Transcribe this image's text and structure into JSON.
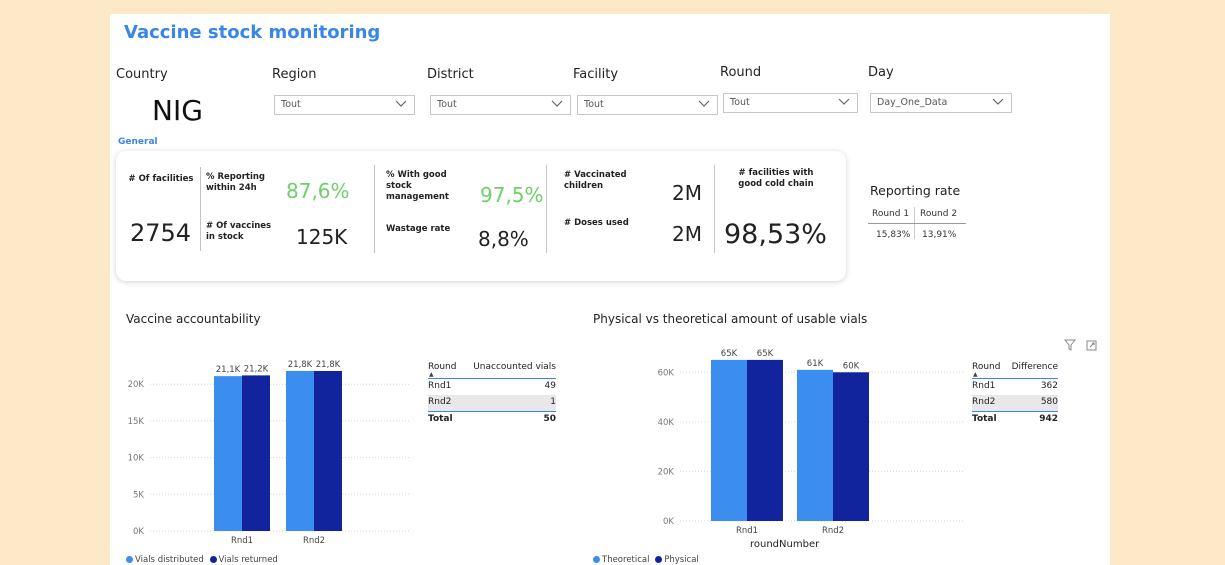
{
  "title": "Vaccine stock monitoring",
  "filters": {
    "country_label": "Country",
    "country_value": "NIG",
    "region_label": "Region",
    "region_value": "Tout",
    "district_label": "District",
    "district_value": "Tout",
    "facility_label": "Facility",
    "facility_value": "Tout",
    "round_label": "Round",
    "round_value": "Tout",
    "day_label": "Day",
    "day_value": "Day_One_Data"
  },
  "general_label": "General",
  "kpis": {
    "facilities_label": "# Of facilities",
    "facilities_value": "2754",
    "reporting_label": "% Reporting within 24h",
    "reporting_value": "87,6%",
    "vaccines_stock_label": "# Of vaccines in stock",
    "vaccines_stock_value": "125K",
    "stock_mgmt_label": "% With good stock management",
    "stock_mgmt_value": "97,5%",
    "wastage_label": "Wastage rate",
    "wastage_value": "8,8%",
    "vaccinated_label": "# Vaccinated children",
    "vaccinated_value": "2M",
    "doses_label": "# Doses used",
    "doses_value": "2M",
    "cold_chain_label": "# facilities with good cold chain",
    "cold_chain_value": "98,53%"
  },
  "reporting_rate": {
    "title": "Reporting rate",
    "headers": [
      "Round 1",
      "Round 2"
    ],
    "values": [
      "15,83%",
      "13,91%"
    ]
  },
  "colors": {
    "light": "#3b8ef0",
    "dark": "#12239e",
    "accent": "#3a86e8",
    "green": "#6fcf6a"
  },
  "accountability": {
    "title": "Vaccine accountability",
    "table": {
      "headers": [
        "Round",
        "Unaccounted vials"
      ],
      "rows": [
        [
          "Rnd1",
          "49"
        ],
        [
          "Rnd2",
          "1"
        ]
      ],
      "total": [
        "Total",
        "50"
      ]
    },
    "legend": [
      "Vials distributed",
      "Vials returned"
    ]
  },
  "physical": {
    "title": "Physical vs theoretical amount of usable vials",
    "xlabel": "roundNumber",
    "table": {
      "headers": [
        "Round",
        "Difference"
      ],
      "rows": [
        [
          "Rnd1",
          "362"
        ],
        [
          "Rnd2",
          "580"
        ]
      ],
      "total": [
        "Total",
        "942"
      ]
    },
    "legend": [
      "Theoretical",
      "Physical"
    ]
  },
  "chart_data": [
    {
      "type": "bar",
      "categories": [
        "Rnd1",
        "Rnd2"
      ],
      "series": [
        {
          "name": "Vials distributed",
          "values": [
            21100,
            21800
          ],
          "labels": [
            "21,1K",
            "21,8K"
          ]
        },
        {
          "name": "Vials returned",
          "values": [
            21200,
            21800
          ],
          "labels": [
            "21,2K",
            "21,8K"
          ]
        }
      ],
      "title": "Vaccine accountability",
      "yticks": [
        "0K",
        "5K",
        "10K",
        "15K",
        "20K"
      ],
      "ylim": [
        0,
        25000
      ],
      "grid": true,
      "legend": "bottom-left"
    },
    {
      "type": "bar",
      "categories": [
        "Rnd1",
        "Rnd2"
      ],
      "series": [
        {
          "name": "Theoretical",
          "values": [
            65000,
            61000
          ],
          "labels": [
            "65K",
            "61K"
          ]
        },
        {
          "name": "Physical",
          "values": [
            65000,
            60000
          ],
          "labels": [
            "65K",
            "60K"
          ]
        }
      ],
      "title": "Physical vs theoretical amount of usable vials",
      "xlabel": "roundNumber",
      "yticks": [
        "0K",
        "20K",
        "40K",
        "60K"
      ],
      "ylim": [
        0,
        70000
      ],
      "grid": true,
      "legend": "bottom-left"
    }
  ]
}
